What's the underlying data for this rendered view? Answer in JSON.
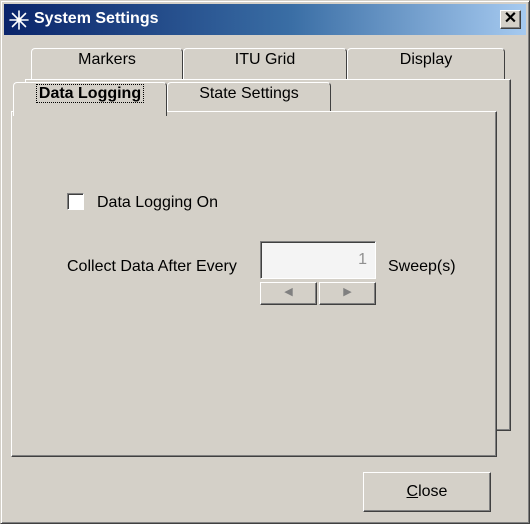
{
  "window": {
    "title": "System Settings",
    "icon": "agilent-spark-icon",
    "close_glyph": "✕"
  },
  "tabs": {
    "row_back": [
      {
        "id": "markers",
        "label": "Markers"
      },
      {
        "id": "itu-grid",
        "label": "ITU Grid"
      },
      {
        "id": "display",
        "label": "Display"
      }
    ],
    "row_front": [
      {
        "id": "data-logging",
        "label": "Data Logging",
        "active": true
      },
      {
        "id": "state-settings",
        "label": "State Settings"
      }
    ]
  },
  "data_logging": {
    "checkbox_label": "Data Logging On",
    "checkbox_checked": false,
    "collect_label": "Collect Data After Every",
    "collect_value": "1",
    "unit_label": "Sweep(s)",
    "spin_left_glyph": "◀",
    "spin_right_glyph": "▶"
  },
  "buttons": {
    "close_mnemonic": "C",
    "close_rest": "lose"
  }
}
